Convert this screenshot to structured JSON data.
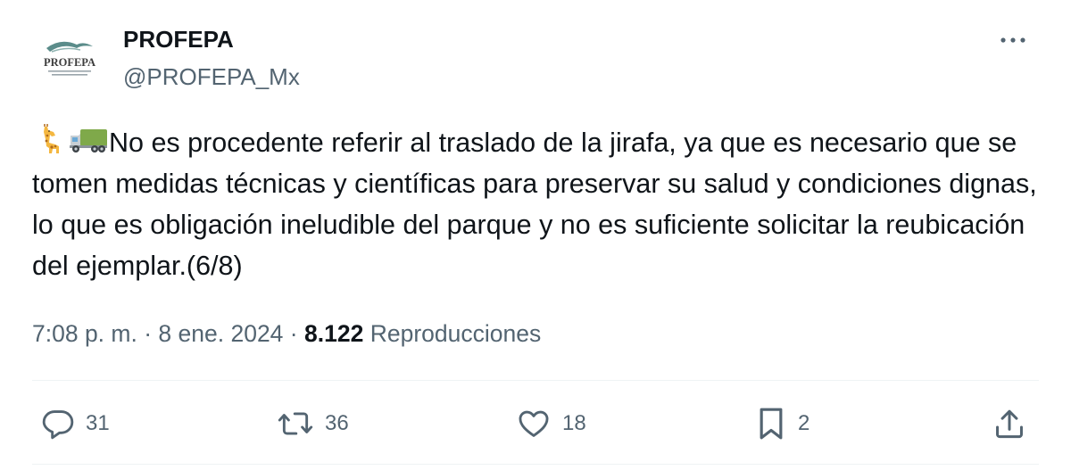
{
  "author": {
    "display_name": "PROFEPA",
    "handle": "@PROFEPA_Mx",
    "avatar_logo_text": "PROFEPA"
  },
  "tweet": {
    "emoji": [
      "🦒",
      "🚛"
    ],
    "text": "No es procedente referir al traslado de la jirafa, ya que es necesario que se tomen medidas técnicas y científicas para preservar su salud y condiciones dignas, lo que es obligación ineludible del parque y no es suficiente solicitar la reubicación del ejemplar.(6/8)"
  },
  "meta": {
    "time": "7:08 p. m.",
    "separator": "·",
    "date": "8 ene. 2024",
    "views_count": "8.122",
    "views_label": "Reproducciones"
  },
  "actions": {
    "replies": "31",
    "retweets": "36",
    "likes": "18",
    "bookmarks": "2"
  },
  "icons": {
    "more": "more-horizontal-icon",
    "reply": "reply-icon",
    "retweet": "retweet-icon",
    "like": "heart-icon",
    "bookmark": "bookmark-icon",
    "share": "share-icon"
  },
  "colors": {
    "text_primary": "#0f1419",
    "text_secondary": "#536471",
    "divider": "#eff3f4",
    "logo_teal": "#5b8c8a"
  }
}
